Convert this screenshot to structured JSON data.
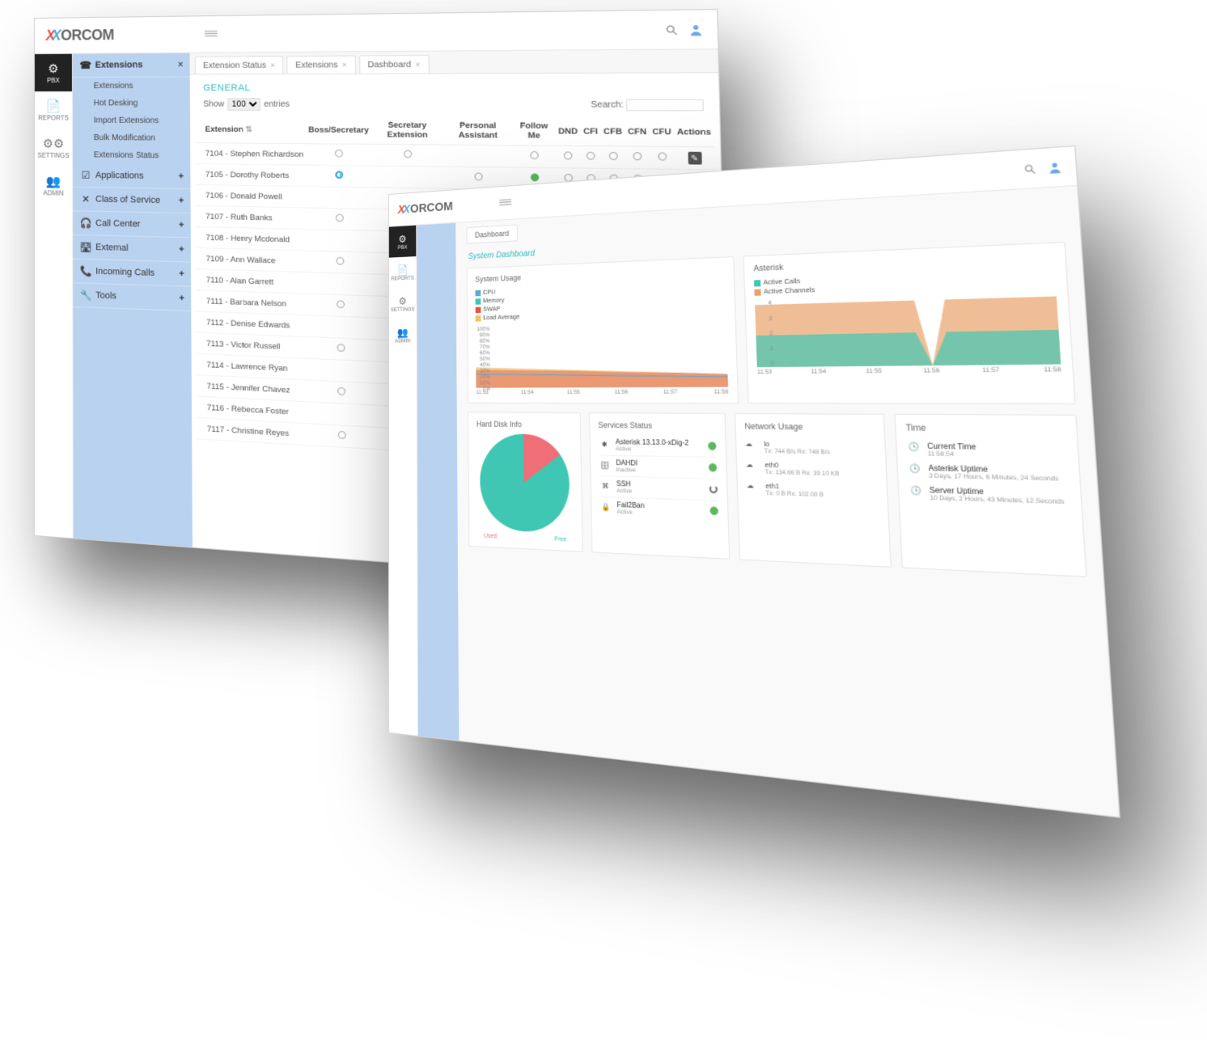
{
  "brand": "ORCOM",
  "win1": {
    "rail": [
      {
        "icon": "⚙",
        "label": "PBX",
        "active": true
      },
      {
        "icon": "📄",
        "label": "REPORTS"
      },
      {
        "icon": "⚙⚙",
        "label": "SETTINGS"
      },
      {
        "icon": "👥",
        "label": "ADMIN"
      }
    ],
    "sidebar": {
      "header": {
        "icon": "☎",
        "label": "Extensions"
      },
      "subs": [
        "Extensions",
        "Hot Desking",
        "Import Extensions",
        "Bulk Modification",
        "Extensions Status"
      ],
      "groups": [
        {
          "icon": "☑",
          "label": "Applications"
        },
        {
          "icon": "✕",
          "label": "Class of Service"
        },
        {
          "icon": "🎧",
          "label": "Call Center"
        },
        {
          "icon": "🛣",
          "label": "External"
        },
        {
          "icon": "📞",
          "label": "Incoming Calls"
        },
        {
          "icon": "🔧",
          "label": "Tools"
        }
      ]
    },
    "tabs": [
      {
        "label": "Extension Status"
      },
      {
        "label": "Extensions"
      },
      {
        "label": "Dashboard"
      }
    ],
    "section": "GENERAL",
    "showLabel": "Show",
    "entriesLabel": "entries",
    "pageSize": "100",
    "searchLabel": "Search:",
    "columns": [
      "Extension",
      "Boss/Secretary",
      "Secretary Extension",
      "Personal Assistant",
      "Follow Me",
      "DND",
      "CFI",
      "CFB",
      "CFN",
      "CFU",
      "Actions"
    ],
    "rows": [
      {
        "ext": "7104 - Stephen Richardson",
        "bs": "o",
        "se": "o",
        "pa": "",
        "fm": "o",
        "dnd": "o",
        "cfi": "o",
        "cfb": "o",
        "cfn": "o",
        "cfu": "o"
      },
      {
        "ext": "7105 - Dorothy Roberts",
        "bs": "clk",
        "se": "",
        "pa": "o",
        "fm": "on",
        "dnd": "o",
        "cfi": "o",
        "cfb": "o",
        "cfn": "o",
        "cfu": "o"
      },
      {
        "ext": "7106 - Donald Powell",
        "bs": "",
        "se": "o",
        "pa": "",
        "fm": "o",
        "dnd": "on",
        "cfi": "o",
        "cfb": "o",
        "cfn": "o",
        "cfu": "o"
      },
      {
        "ext": "7107 - Ruth Banks",
        "bs": "o",
        "se": "",
        "pa": "o",
        "fm": "o",
        "dnd": "on",
        "cfi": "on",
        "cfb": "o",
        "cfn": "on",
        "cfu": "o"
      },
      {
        "ext": "7108 - Henry Mcdonald",
        "bs": "",
        "se": "o",
        "pa": "",
        "fm": "o",
        "dnd": "o",
        "cfi": "on",
        "cfb": "on",
        "cfn": "o",
        "cfu": "on"
      },
      {
        "ext": "7109 - Ann Wallace",
        "bs": "o",
        "se": "",
        "pa": "o",
        "fm": "",
        "dnd": "o",
        "cfi": "",
        "cfb": "on",
        "cfn": "on",
        "cfu": "o"
      },
      {
        "ext": "7110 - Alan Garrett",
        "bs": "",
        "se": "o",
        "pa": "",
        "fm": "o",
        "dnd": "",
        "cfi": "o",
        "cfb": "",
        "cfn": "on",
        "cfu": "on"
      },
      {
        "ext": "7111 - Barbara Nelson",
        "bs": "o",
        "se": "",
        "pa": "o",
        "fm": "",
        "dnd": "o",
        "cfi": "",
        "cfb": "o",
        "cfn": "",
        "cfu": "on"
      },
      {
        "ext": "7112 - Denise Edwards",
        "bs": "",
        "se": "o",
        "pa": "",
        "fm": "o",
        "dnd": "",
        "cfi": "o",
        "cfb": "",
        "cfn": "o",
        "cfu": ""
      },
      {
        "ext": "7113 - Victor Russell",
        "bs": "o",
        "se": "",
        "pa": "o",
        "fm": "",
        "dnd": "o",
        "cfi": "",
        "cfb": "o",
        "cfn": "",
        "cfu": "o"
      },
      {
        "ext": "7114 - Lawrence Ryan",
        "bs": "",
        "se": "o",
        "pa": "",
        "fm": "o",
        "dnd": "",
        "cfi": "o",
        "cfb": "",
        "cfn": "o",
        "cfu": ""
      },
      {
        "ext": "7115 - Jennifer Chavez",
        "bs": "o",
        "se": "",
        "pa": "o",
        "fm": "",
        "dnd": "o",
        "cfi": "",
        "cfb": "o",
        "cfn": "",
        "cfu": "o"
      },
      {
        "ext": "7116 - Rebecca Foster",
        "bs": "",
        "se": "o",
        "pa": "",
        "fm": "o",
        "dnd": "",
        "cfi": "o",
        "cfb": "",
        "cfn": "o",
        "cfu": ""
      },
      {
        "ext": "7117 - Christine Reyes",
        "bs": "o",
        "se": "",
        "pa": "o",
        "fm": "",
        "dnd": "o",
        "cfi": "",
        "cfb": "o",
        "cfn": "",
        "cfu": "o"
      }
    ]
  },
  "win2": {
    "rail": [
      {
        "icon": "⚙",
        "label": "PBX",
        "active": true
      },
      {
        "icon": "📄",
        "label": "REPORTS"
      },
      {
        "icon": "⚙",
        "label": "SETTINGS"
      },
      {
        "icon": "👥",
        "label": "ADMIN"
      }
    ],
    "tab": "Dashboard",
    "title": "System Dashboard",
    "cards": {
      "sysUsage": {
        "title": "System Usage",
        "legend": [
          {
            "color": "#5aa9d6",
            "label": "CPU"
          },
          {
            "color": "#3fc7b3",
            "label": "Memory"
          },
          {
            "color": "#e8533f",
            "label": "SWAP"
          },
          {
            "color": "#e9c36a",
            "label": "Load Average"
          }
        ],
        "yticks": [
          "100%",
          "90%",
          "80%",
          "70%",
          "60%",
          "50%",
          "40%",
          "30%",
          "20%",
          "10%",
          "0%"
        ],
        "xticks": [
          "11:53",
          "11:54",
          "11:55",
          "11:56",
          "11:57",
          "11:58"
        ]
      },
      "asterisk": {
        "title": "Asterisk",
        "legend": [
          {
            "color": "#3fc7b3",
            "label": "Active Calls"
          },
          {
            "color": "#e9a36a",
            "label": "Active Channels"
          }
        ],
        "yticks": [
          "4",
          "3",
          "2",
          "1",
          "0"
        ],
        "xticks": [
          "11:53",
          "11:54",
          "11:55",
          "11:56",
          "11:57",
          "11:58"
        ]
      },
      "disk": {
        "title": "Hard Disk Info",
        "labels": {
          "left": "Used",
          "right": "Free"
        },
        "used_pct": 15
      },
      "services": {
        "title": "Services Status",
        "items": [
          {
            "icon": "✱",
            "name": "Asterisk 13.13.0-xDig-2",
            "sub": "Active",
            "state": "ok"
          },
          {
            "icon": "🗄",
            "name": "DAHDI",
            "sub": "Inactive",
            "state": "ok"
          },
          {
            "icon": "⌘",
            "name": "SSH",
            "sub": "Active",
            "state": "loading"
          },
          {
            "icon": "🔒",
            "name": "Fail2Ban",
            "sub": "Active",
            "state": "ok"
          }
        ]
      },
      "network": {
        "title": "Network Usage",
        "items": [
          {
            "name": "lo",
            "sub": "Tx: 744 B/s  Rx: 748 B/s"
          },
          {
            "name": "eth0",
            "sub": "Tx: 134.66 B  Rx: 39.10 KB"
          },
          {
            "name": "eth1",
            "sub": "Tx: 0 B  Rx: 102.00 B"
          }
        ]
      },
      "time": {
        "title": "Time",
        "items": [
          {
            "icon": "🕒",
            "name": "Current Time",
            "sub": "11:58:54"
          },
          {
            "icon": "🕒",
            "name": "Asterisk Uptime",
            "sub": "3 Days, 17 Hours, 6 Minutes, 24 Seconds"
          },
          {
            "icon": "🕒",
            "name": "Server Uptime",
            "sub": "10 Days, 2 Hours, 43 Minutes, 12 Seconds"
          }
        ]
      }
    }
  },
  "chart_data": [
    {
      "type": "area",
      "title": "System Usage",
      "x": [
        "11:53",
        "11:54",
        "11:55",
        "11:56",
        "11:57",
        "11:58"
      ],
      "ylim": [
        0,
        100
      ],
      "ylabel": "%",
      "series": [
        {
          "name": "CPU",
          "color": "#5aa9d6",
          "values": [
            22,
            21,
            20,
            19,
            18,
            17
          ]
        },
        {
          "name": "Memory",
          "color": "#3fc7b3",
          "values": [
            30,
            29,
            28,
            27,
            26,
            25
          ]
        },
        {
          "name": "SWAP",
          "color": "#e8533f",
          "values": [
            2,
            2,
            2,
            2,
            2,
            2
          ]
        },
        {
          "name": "Load Average",
          "color": "#e9c36a",
          "values": [
            35,
            34,
            32,
            30,
            28,
            26
          ]
        }
      ]
    },
    {
      "type": "area",
      "title": "Asterisk",
      "x": [
        "11:53",
        "11:54",
        "11:55",
        "11:56",
        "11:57",
        "11:58"
      ],
      "ylim": [
        0,
        4
      ],
      "series": [
        {
          "name": "Active Calls",
          "color": "#3fc7b3",
          "values": [
            2,
            2,
            2,
            0,
            2,
            2
          ]
        },
        {
          "name": "Active Channels",
          "color": "#e9a36a",
          "values": [
            4,
            4,
            4,
            0,
            4,
            4
          ]
        }
      ]
    },
    {
      "type": "pie",
      "title": "Hard Disk Info",
      "categories": [
        "Used",
        "Free"
      ],
      "values": [
        15,
        85
      ]
    }
  ]
}
